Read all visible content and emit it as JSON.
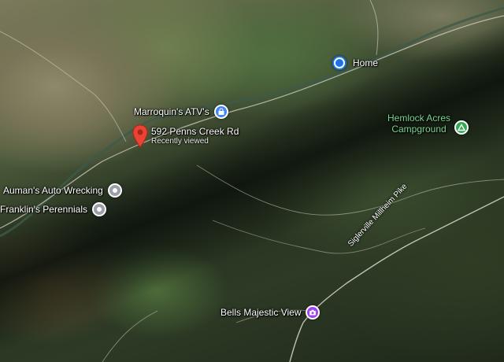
{
  "places": {
    "home": {
      "label": "Home",
      "icon": "home-location-icon",
      "color": "#1a73e8"
    },
    "marroquin": {
      "label": "Marroquin's ATV's",
      "icon": "shopping-bag-icon",
      "color": "#4285f4"
    },
    "penns_creek": {
      "label": "592 Penns Creek Rd",
      "sublabel": "Recently viewed",
      "icon": "red-pin-icon",
      "color": "#ea4335"
    },
    "hemlock": {
      "label_line1": "Hemlock Acres",
      "label_line2": "Campground",
      "icon": "campground-icon",
      "color": "#34a853"
    },
    "aumans": {
      "label": "Auman's Auto Wrecking",
      "icon": "place-icon",
      "color": "#9aa0a6"
    },
    "franklins": {
      "label": "Franklin's Perennials",
      "icon": "place-icon",
      "color": "#9aa0a6"
    },
    "bells": {
      "label": "Bells Majestic View",
      "icon": "camera-icon",
      "color": "#a142f4"
    }
  },
  "roads": {
    "siglerville": "Siglerville Millheim Pike"
  }
}
